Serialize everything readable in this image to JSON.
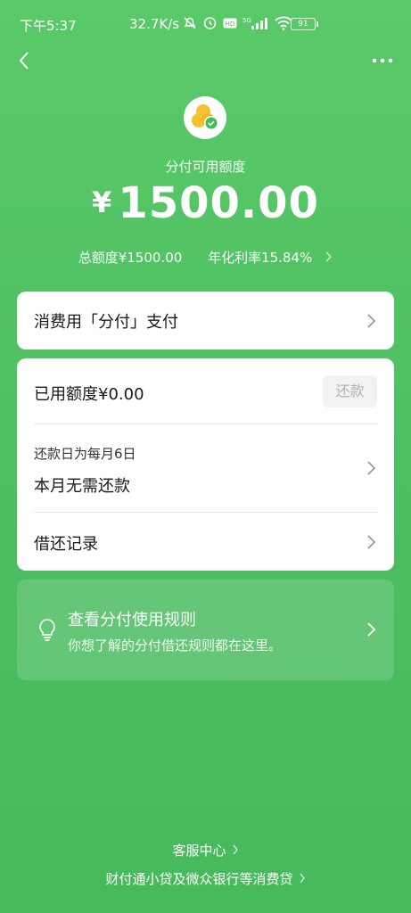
{
  "status_bar": {
    "time": "下午5:37",
    "speed": "32.7K/s",
    "battery": "91",
    "icons": [
      "whatsapp-small-icon",
      "mute-icon",
      "alarm-icon",
      "hd-icon",
      "5g-signal-icon",
      "wifi-icon"
    ]
  },
  "header": {
    "back_icon": "chevron-left-icon",
    "more_icon": "more-dots-icon"
  },
  "credit": {
    "title": "分付可用额度",
    "currency": "¥",
    "available": "1500.00",
    "total_label": "总额度¥1500.00",
    "rate_label": "年化利率15.84%"
  },
  "card_pay": {
    "label": "消费用「分付」支付"
  },
  "card_usage": {
    "used_label": "已用额度¥0.00",
    "repay_button": "还款",
    "repay_day": "还款日为每月6日",
    "repay_status": "本月无需还款",
    "records_label": "借还记录"
  },
  "tip": {
    "title": "查看分付使用规则",
    "subtitle": "你想了解的分付借还规则都在这里。"
  },
  "footer": {
    "service": "客服中心",
    "lender": "财付通小贷及微众银行等消费贷"
  },
  "colors": {
    "background": "#4dbf62",
    "card": "#ffffff",
    "logo_yellow": "#f5c12e",
    "logo_green": "#3cbf5a"
  }
}
